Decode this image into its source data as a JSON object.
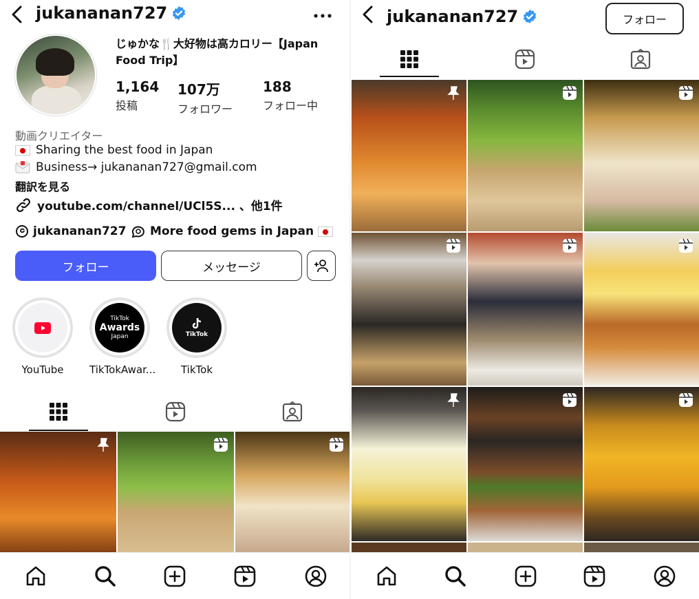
{
  "left": {
    "username": "jukananan727",
    "bio_title": "じゅかな🍴大好物は高カロリー【Japan Food Trip】",
    "stats": [
      {
        "num": "1,164",
        "label": "投稿"
      },
      {
        "num": "107万",
        "label": "フォロワー"
      },
      {
        "num": "188",
        "label": "フォロー中"
      }
    ],
    "category": "動画クリエイター",
    "bio_line1": "Sharing the best food in Japan",
    "bio_line2": "Business→ jukananan727@gmail.com",
    "translate": "翻訳を見る",
    "link": "youtube.com/channel/UCl5S... 、他1件",
    "threads_handle": "jukananan727",
    "gems": "More food gems in Japan",
    "follow": "フォロー",
    "message": "メッセージ",
    "highlights": [
      {
        "label": "YouTube"
      },
      {
        "label": "TikTokAwar..."
      },
      {
        "label": "TikTok"
      }
    ],
    "highlight_text": {
      "awards_top": "TikTok",
      "awards_mid": "Awards",
      "awards_bot": "Japan",
      "tiktok": "TikTok"
    }
  },
  "right": {
    "username": "jukananan727",
    "follow": "フォロー"
  },
  "colors": {
    "accent": "#4a5df9",
    "verified": "#3797f0"
  }
}
